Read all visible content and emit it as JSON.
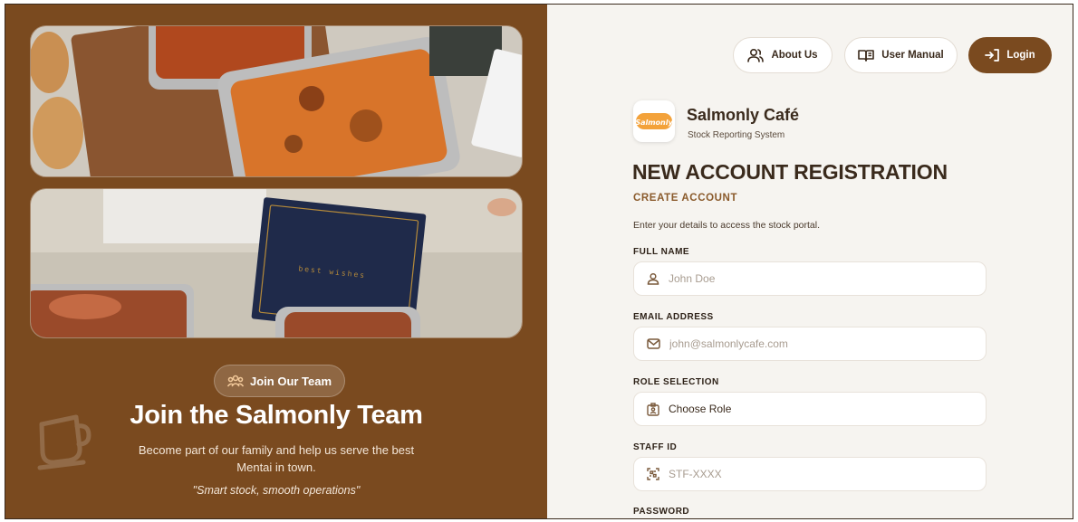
{
  "left": {
    "badge_label": "Join Our Team",
    "title": "Join the Salmonly Team",
    "description": "Become part of our family and help us serve the best Mentai in town.",
    "quote": "\"Smart stock, smooth operations\"",
    "card_text": "best wishes"
  },
  "nav": {
    "about_label": "About Us",
    "manual_label": "User Manual",
    "login_label": "Login"
  },
  "brand": {
    "logo_text": "Salmonly",
    "name": "Salmonly Café",
    "subtitle": "Stock Reporting System"
  },
  "form": {
    "heading": "NEW ACCOUNT REGISTRATION",
    "subheading": "CREATE ACCOUNT",
    "intro": "Enter your details to access the stock portal.",
    "full_name": {
      "label": "FULL NAME",
      "placeholder": "John Doe",
      "value": ""
    },
    "email": {
      "label": "EMAIL ADDRESS",
      "placeholder": "john@salmonlycafe.com",
      "value": ""
    },
    "role": {
      "label": "ROLE SELECTION",
      "selected": "Choose Role"
    },
    "staff_id": {
      "label": "STAFF ID",
      "placeholder": "STF-XXXX",
      "value": ""
    },
    "password": {
      "label": "PASSWORD"
    }
  },
  "colors": {
    "brand_brown": "#7a4a1f",
    "panel_bg": "#f6f4f0",
    "accent": "#8a5a2b"
  }
}
